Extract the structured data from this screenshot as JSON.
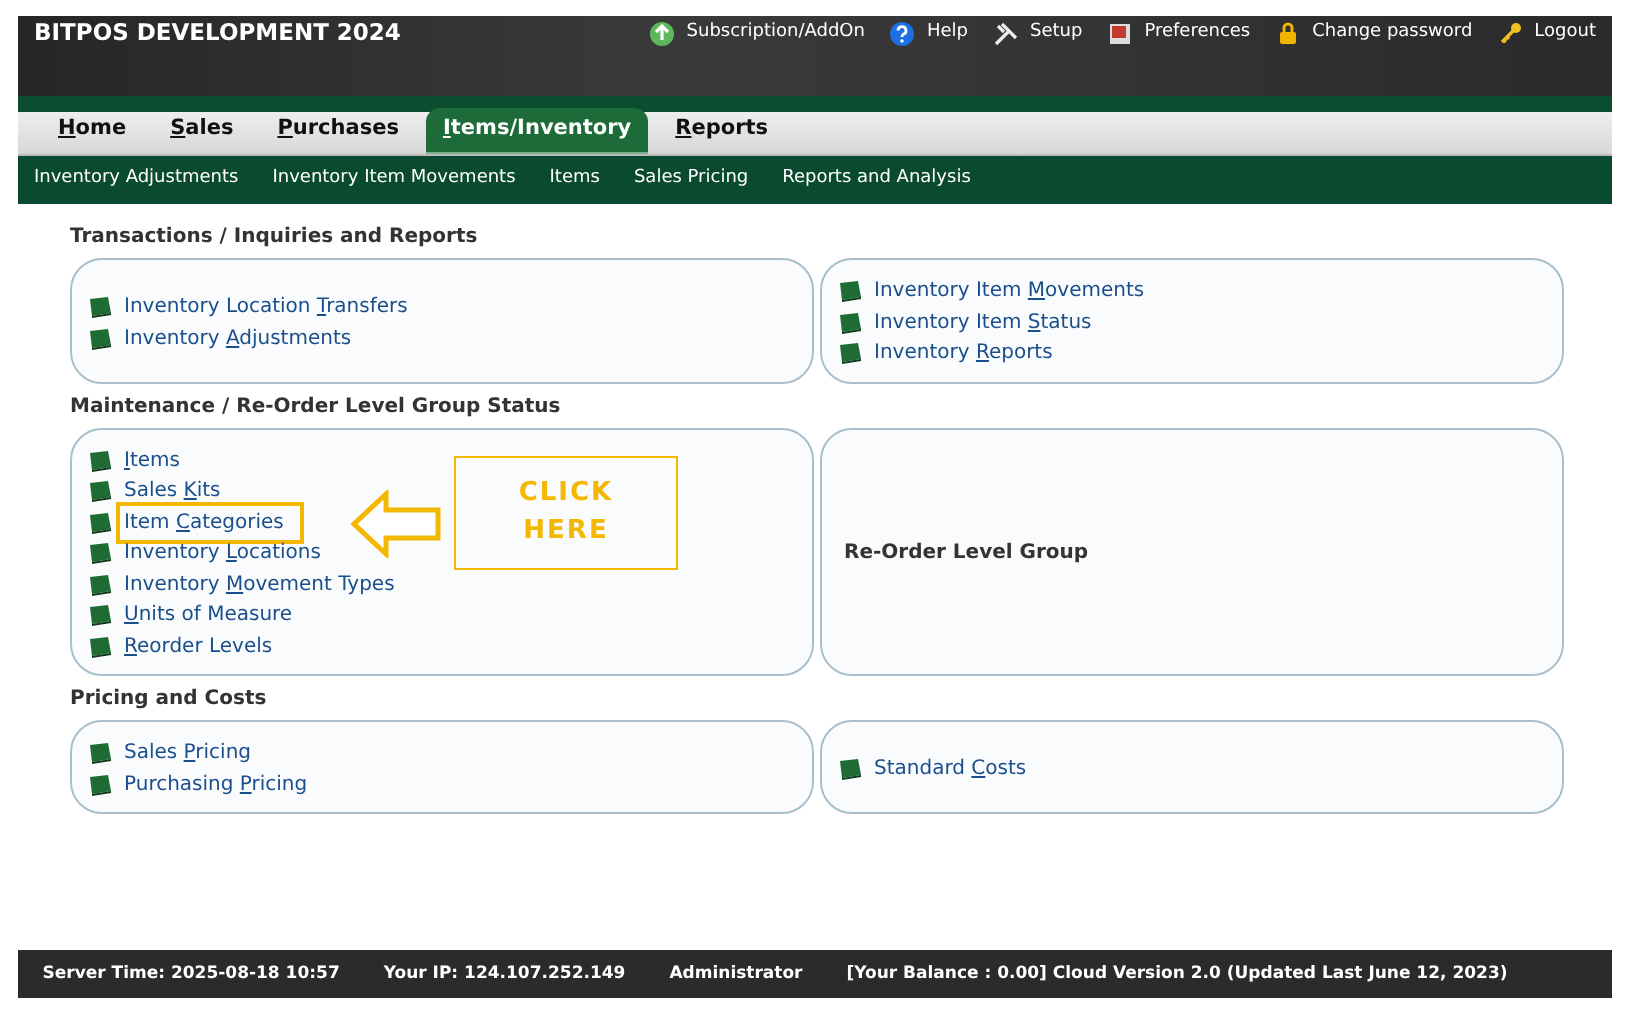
{
  "header": {
    "title": "BITPOS DEVELOPMENT 2024",
    "links": [
      {
        "kind": "addon",
        "label": "Subscription/AddOn"
      },
      {
        "kind": "help",
        "label": "Help"
      },
      {
        "kind": "setup",
        "label": "Setup"
      },
      {
        "kind": "preferences",
        "label": "Preferences"
      },
      {
        "kind": "lock",
        "label": "Change password"
      },
      {
        "kind": "logout",
        "label": "Logout"
      }
    ]
  },
  "tabs": [
    {
      "key": "H",
      "post": "ome",
      "selected": false
    },
    {
      "key": "S",
      "post": "ales",
      "selected": false
    },
    {
      "key": "P",
      "post": "urchases",
      "selected": false
    },
    {
      "key": "I",
      "post": "tems/Inventory",
      "selected": true
    },
    {
      "key": "R",
      "post": "eports",
      "selected": false
    }
  ],
  "submenu": [
    "Inventory Adjustments",
    "Inventory Item Movements",
    "Items",
    "Sales Pricing",
    "Reports and Analysis"
  ],
  "sections": [
    {
      "heading": "Transactions / Inquiries and Reports",
      "panels": [
        {
          "links": [
            {
              "pre": "Inventory Location ",
              "key": "T",
              "post": "ransfers"
            },
            {
              "pre": "Inventory ",
              "key": "A",
              "post": "djustments"
            }
          ]
        },
        {
          "links": [
            {
              "pre": "Inventory Item ",
              "key": "M",
              "post": "ovements"
            },
            {
              "pre": "Inventory Item ",
              "key": "S",
              "post": "tatus"
            },
            {
              "pre": "Inventory ",
              "key": "R",
              "post": "eports"
            }
          ]
        }
      ]
    },
    {
      "heading": "Maintenance / Re-Order Level Group Status",
      "panels": [
        {
          "links": [
            {
              "key": "I",
              "post": "tems"
            },
            {
              "pre": "Sales ",
              "key": "K",
              "post": "its"
            },
            {
              "pre": "Item ",
              "key": "C",
              "post": "ategories",
              "highlighted": true
            },
            {
              "pre": "Inventory ",
              "key": "L",
              "post": "ocations"
            },
            {
              "pre": "Inventory ",
              "key": "M",
              "post": "ovement Types"
            },
            {
              "key": "U",
              "post": "nits of Measure"
            },
            {
              "key": "R",
              "post": "eorder Levels"
            }
          ]
        },
        {
          "caption": "Re-Order Level Group"
        }
      ]
    },
    {
      "heading": "Pricing and Costs",
      "panels": [
        {
          "links": [
            {
              "pre": "Sales ",
              "key": "P",
              "post": "ricing"
            },
            {
              "pre": "Purchasing ",
              "key": "P",
              "post": "ricing"
            }
          ]
        },
        {
          "links": [
            {
              "pre": "Standard ",
              "key": "C",
              "post": "osts"
            }
          ]
        }
      ]
    }
  ],
  "callout": {
    "text": "CLICK HERE"
  },
  "footer": [
    "Server Time: 2025-08-18 10:57",
    "Your IP: 124.107.252.149",
    "Administrator",
    "[Your Balance : 0.00] Cloud Version 2.0 (Updated Last June 12, 2023)"
  ]
}
